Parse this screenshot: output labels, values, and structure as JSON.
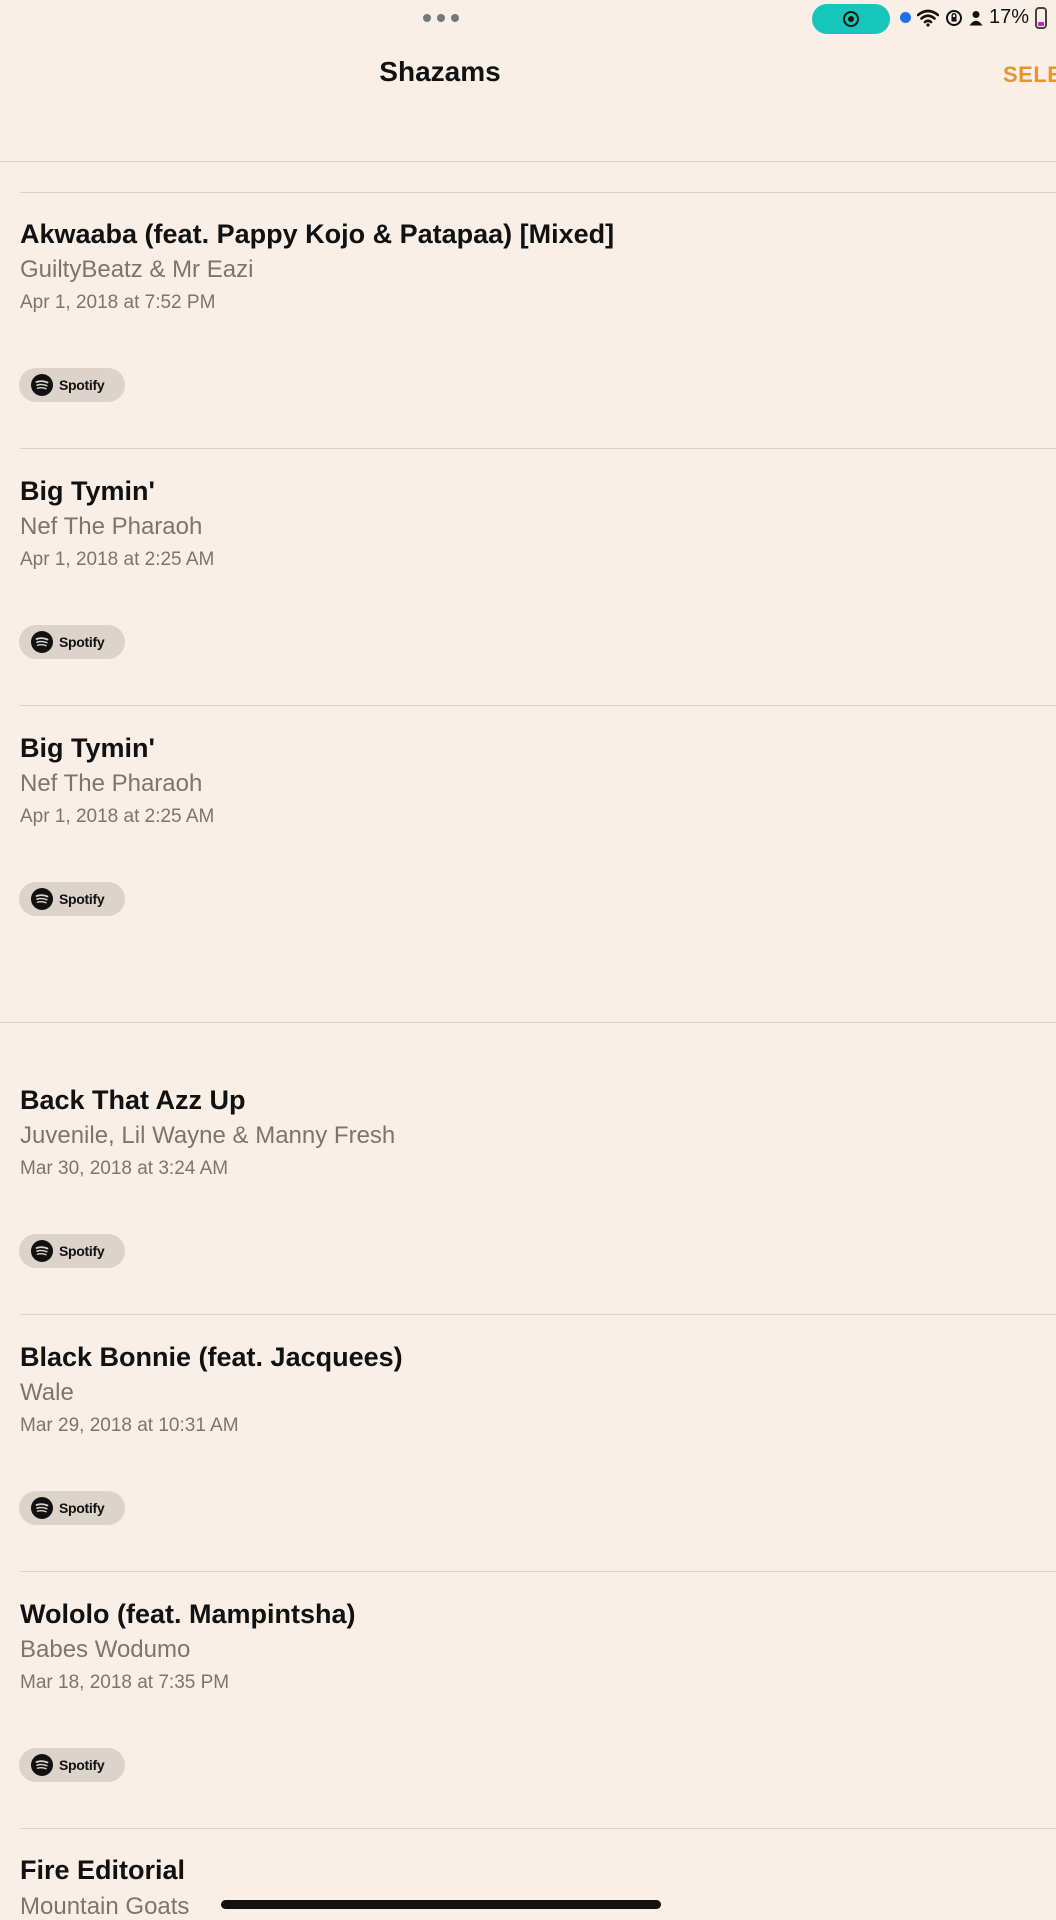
{
  "status_bar": {
    "battery_percent": "17%",
    "recording_active": true
  },
  "nav": {
    "title": "Shazams",
    "select_label": "SELE"
  },
  "songs": [
    {
      "title": "Akwaaba (feat. Pappy Kojo & Patapaa) [Mixed]",
      "artist": "GuiltyBeatz & Mr Eazi",
      "date": "Apr 1, 2018 at 7:52 PM",
      "chip": "Spotify"
    },
    {
      "title": "Big Tymin'",
      "artist": "Nef The Pharaoh",
      "date": "Apr 1, 2018 at 2:25 AM",
      "chip": "Spotify"
    },
    {
      "title": "Big Tymin'",
      "artist": "Nef The Pharaoh",
      "date": "Apr 1, 2018 at 2:25 AM",
      "chip": "Spotify"
    },
    {
      "title": "Back That Azz Up",
      "artist": "Juvenile, Lil Wayne & Manny Fresh",
      "date": "Mar 30, 2018 at 3:24 AM",
      "chip": "Spotify"
    },
    {
      "title": "Black Bonnie (feat. Jacquees)",
      "artist": "Wale",
      "date": "Mar 29, 2018 at 10:31 AM",
      "chip": "Spotify"
    },
    {
      "title": "Wololo (feat. Mampintsha)",
      "artist": "Babes Wodumo",
      "date": "Mar 18, 2018 at 7:35 PM",
      "chip": "Spotify"
    }
  ],
  "partial_song": {
    "title": "Fire Editorial",
    "artist": "Mountain Goats"
  },
  "colors": {
    "background": "#f9efe6",
    "accent": "#e8932d",
    "record_pill": "#16c6ba",
    "chip_bg": "#dcd3cb",
    "secondary_text": "#7c756f"
  }
}
